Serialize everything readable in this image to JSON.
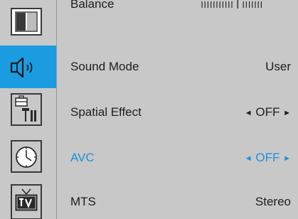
{
  "sidebar": {
    "items": [
      {
        "icon": "picture-icon",
        "active": false
      },
      {
        "icon": "speaker-icon",
        "active": true
      },
      {
        "icon": "setup-tools-icon",
        "active": false
      },
      {
        "icon": "clock-icon",
        "active": false
      },
      {
        "icon": "tv-icon",
        "active": false
      }
    ]
  },
  "menu": {
    "rows": [
      {
        "label": "Balance",
        "value": "",
        "selected": false
      },
      {
        "label": "Sound Mode",
        "value": "User",
        "selected": false
      },
      {
        "label": "Spatial Effect",
        "value": "OFF",
        "left_arrow": "◄",
        "right_arrow": "►",
        "selected": false
      },
      {
        "label": "AVC",
        "value": "OFF",
        "left_arrow": "◄",
        "right_arrow": "►",
        "selected": true
      },
      {
        "label": "MTS",
        "value": "Stereo",
        "selected": false
      }
    ],
    "balance": {
      "left_ticks": 11,
      "right_ticks": 7,
      "level": 0.5
    }
  },
  "colors": {
    "background": "#c8c8c8",
    "active_tab": "#1b9be0",
    "selected_text": "#1e8fd8",
    "text": "#1e1e1e"
  }
}
